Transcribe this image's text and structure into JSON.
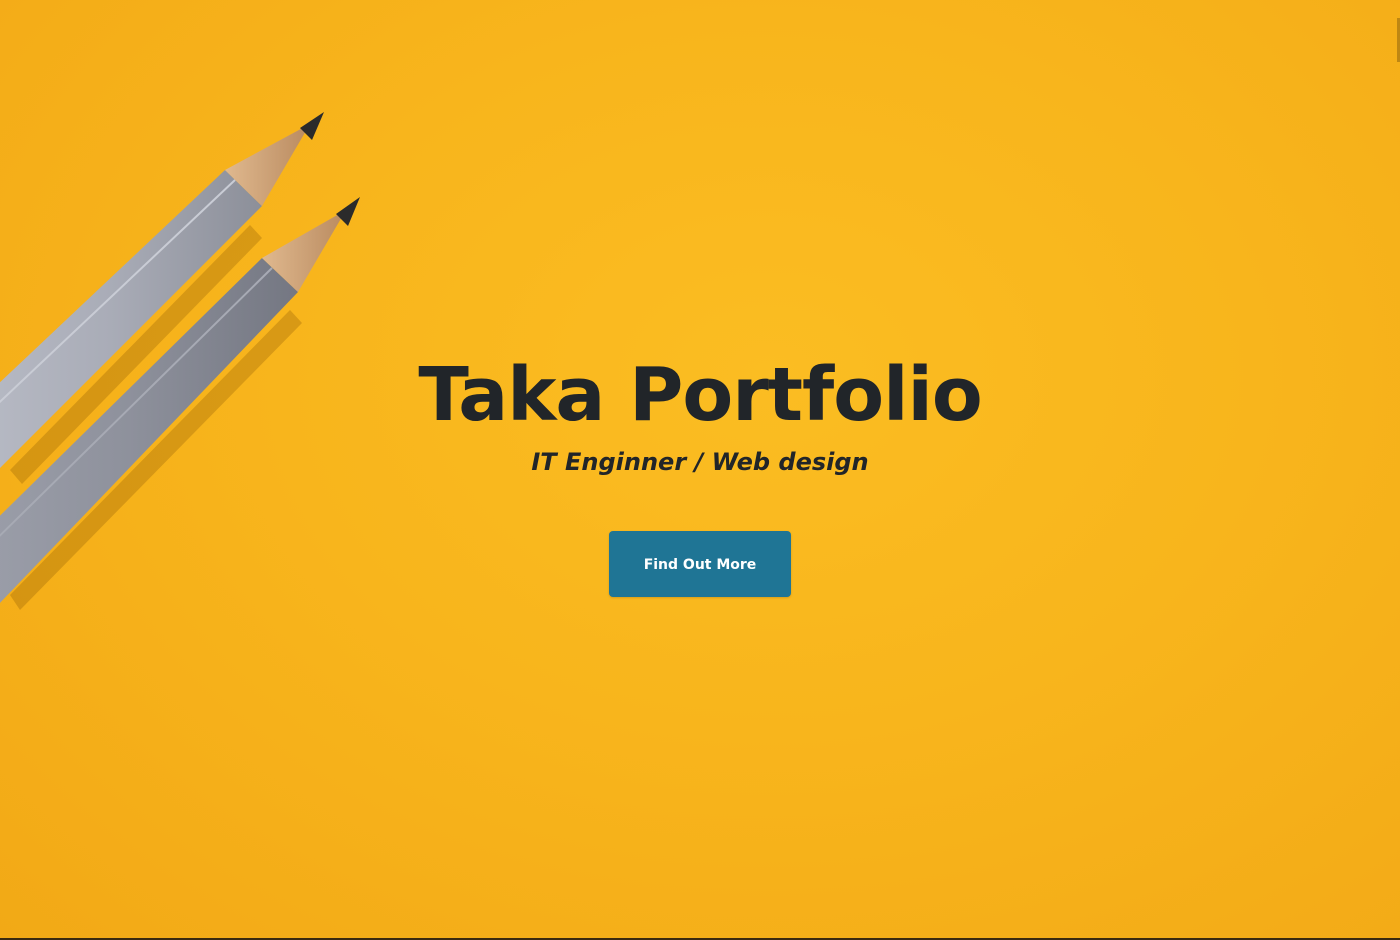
{
  "hero": {
    "title": "Taka Portfolio",
    "subtitle": "IT Enginner / Web design",
    "cta_label": "Find Out More"
  },
  "colors": {
    "background": "#f8b51c",
    "text": "#212529",
    "button": "#1f7595",
    "button_text": "#ffffff"
  },
  "icons": {
    "decoration": "pencils-image"
  }
}
